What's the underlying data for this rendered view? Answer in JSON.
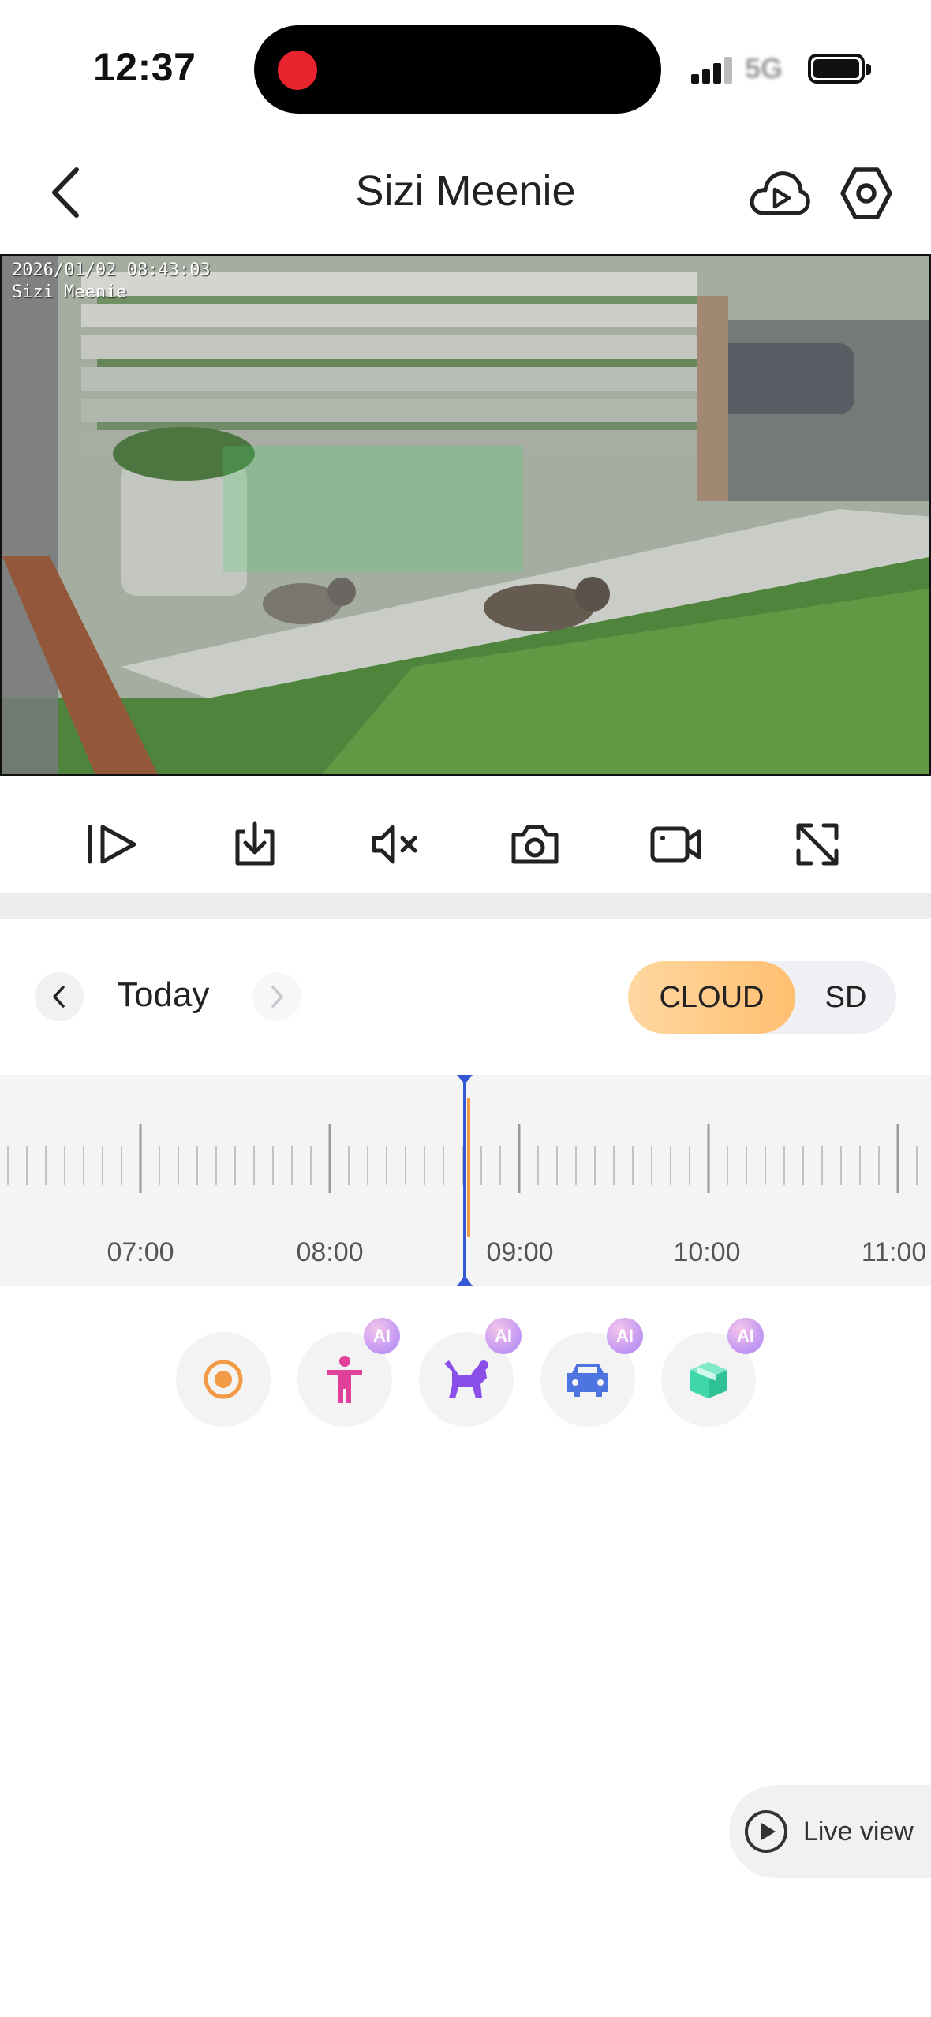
{
  "status_bar": {
    "time": "12:37",
    "network": "5G"
  },
  "nav": {
    "title": "Sizi Meenie",
    "back_icon": "chevron-left-icon",
    "cloud_icon": "cloud-play-icon",
    "settings_icon": "hexagon-settings-icon"
  },
  "video": {
    "timestamp": "2026/01/02 08:43:03",
    "camera_label": "Sizi Meenie"
  },
  "toolbar": {
    "items": [
      {
        "name": "playback-speed-button",
        "icon": "play-forward-icon"
      },
      {
        "name": "download-button",
        "icon": "download-icon"
      },
      {
        "name": "mute-button",
        "icon": "speaker-muted-icon"
      },
      {
        "name": "snapshot-button",
        "icon": "camera-icon"
      },
      {
        "name": "record-button",
        "icon": "video-camera-icon"
      },
      {
        "name": "fullscreen-button",
        "icon": "expand-icon"
      }
    ]
  },
  "date_nav": {
    "label": "Today"
  },
  "storage": {
    "options": [
      "CLOUD",
      "SD"
    ],
    "selected": "CLOUD",
    "active_color": "#ffc47c"
  },
  "timeline": {
    "labels": [
      "07:00",
      "08:00",
      "09:00",
      "10:00",
      "11:00"
    ],
    "cursor_color": "#3457d5",
    "event_color": "#f29a45"
  },
  "filters": {
    "items": [
      {
        "name": "all-events",
        "icon": "record-dot-icon",
        "color": "#f29a45",
        "ai": false
      },
      {
        "name": "person",
        "icon": "person-icon",
        "color": "#e0409a",
        "ai": true
      },
      {
        "name": "pet",
        "icon": "dog-icon",
        "color": "#8a4fe8",
        "ai": true
      },
      {
        "name": "vehicle",
        "icon": "car-icon",
        "color": "#4d74e0",
        "ai": true
      },
      {
        "name": "package",
        "icon": "package-icon",
        "color": "#3fd6a8",
        "ai": true
      }
    ],
    "ai_badge": "AI"
  },
  "live_view": {
    "label": "Live view"
  }
}
